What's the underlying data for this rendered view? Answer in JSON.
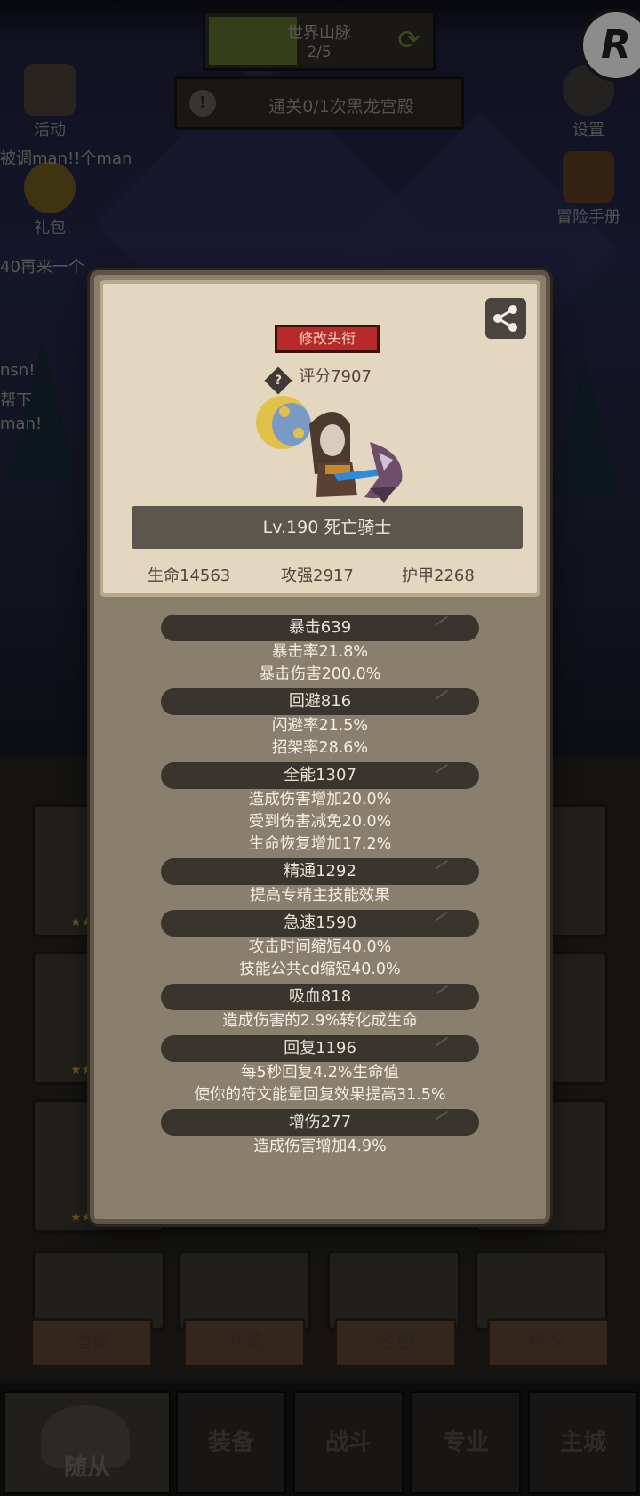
{
  "hud": {
    "progress_title": "世界山脉",
    "progress_count": "2/5",
    "progress_ratio": 0.4,
    "quest_text": "通关0/1次黑龙宫殿",
    "corner_badge": "R"
  },
  "side_icons": {
    "activity": "活动",
    "gift": "礼包",
    "settings": "设置",
    "handbook": "冒险手册"
  },
  "chat_lines": [
    "被调man!!个man",
    "40再来一个",
    "nsn!",
    "帮下",
    "man!"
  ],
  "modal": {
    "title_button": "修改头衔",
    "score": "评分7907",
    "hero_name": "Lv.190 死亡骑士",
    "stats": {
      "hp": "生命14563",
      "attack": "攻强2917",
      "armor": "护甲2268"
    },
    "attributes": [
      {
        "name": "暴击639",
        "lines": [
          "暴击率21.8%",
          "暴击伤害200.0%"
        ]
      },
      {
        "name": "回避816",
        "lines": [
          "闪避率21.5%",
          "招架率28.6%"
        ]
      },
      {
        "name": "全能1307",
        "lines": [
          "造成伤害增加20.0%",
          "受到伤害减免20.0%",
          "生命恢复增加17.2%"
        ]
      },
      {
        "name": "精通1292",
        "lines": [
          "提高专精主技能效果"
        ]
      },
      {
        "name": "急速1590",
        "lines": [
          "攻击时间缩短40.0%",
          "技能公共cd缩短40.0%"
        ]
      },
      {
        "name": "吸血818",
        "lines": [
          "造成伤害的2.9%转化成生命"
        ]
      },
      {
        "name": "回复1196",
        "lines": [
          "每5秒回复4.2%生命值",
          "使你的符文能量回复效果提高31.5%"
        ]
      },
      {
        "name": "增伤277",
        "lines": [
          "造成伤害增加4.9%"
        ]
      }
    ]
  },
  "lower_buttons": [
    "酒馆",
    "派遣",
    "名望",
    "符文"
  ],
  "nav": {
    "followers": "随从",
    "equipment": "装备",
    "battle": "战斗",
    "profession": "专业",
    "city": "主城"
  },
  "colors": {
    "title_button_red": "#b72a2a",
    "card_parchment": "#e3d7bf",
    "modal_frame": "#8a7e6d",
    "attr_head": "#39342e"
  }
}
